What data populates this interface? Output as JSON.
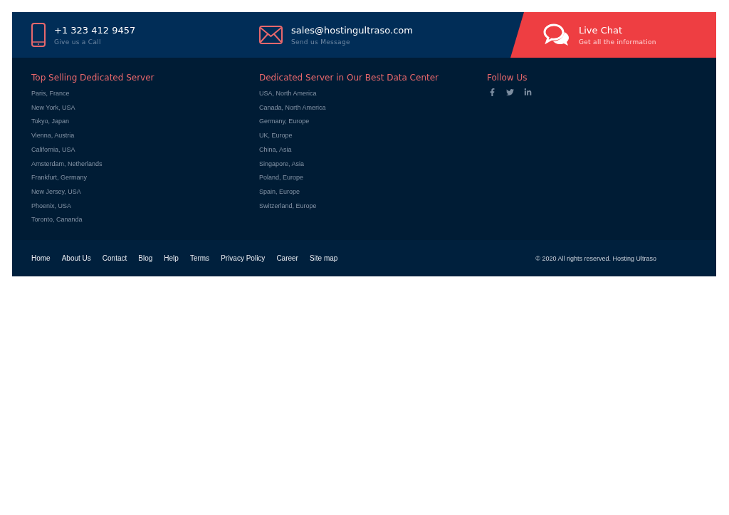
{
  "contact_bar": {
    "phone": {
      "value": "+1 323 412 9457",
      "caption": "Give us a Call"
    },
    "email": {
      "value": "sales@hostingultraso.com",
      "caption": "Send us Message"
    },
    "live_chat": {
      "title": "Live Chat",
      "caption": "Get all the information"
    }
  },
  "columns": [
    {
      "heading": "Top Selling Dedicated Server",
      "links": [
        "Paris, France",
        "New York, USA",
        "Tokyo, Japan",
        "Vienna, Austria",
        "California, USA",
        "Amsterdam, Netherlands",
        "Frankfurt, Germany",
        "New Jersey, USA",
        "Phoenix, USA",
        "Toronto, Cananda"
      ]
    },
    {
      "heading": "Dedicated Server in Our Best Data Center",
      "links": [
        "USA, North America",
        "Canada, North America",
        "Germany, Europe",
        "UK, Europe",
        "China, Asia",
        "Singapore, Asia",
        "Poland, Europe",
        "Spain, Europe",
        "Switzerland, Europe"
      ]
    }
  ],
  "follow": {
    "heading": "Follow Us",
    "social": [
      {
        "kind": "facebook"
      },
      {
        "kind": "twitter"
      },
      {
        "kind": "linkedin"
      }
    ]
  },
  "bottom_nav": [
    "Home",
    "About Us",
    "Contact",
    "Blog",
    "Help",
    "Terms",
    "Privacy Policy",
    "Career",
    "Site map"
  ],
  "copyright": "© 2020 All rights reserved. Hosting Ultraso"
}
